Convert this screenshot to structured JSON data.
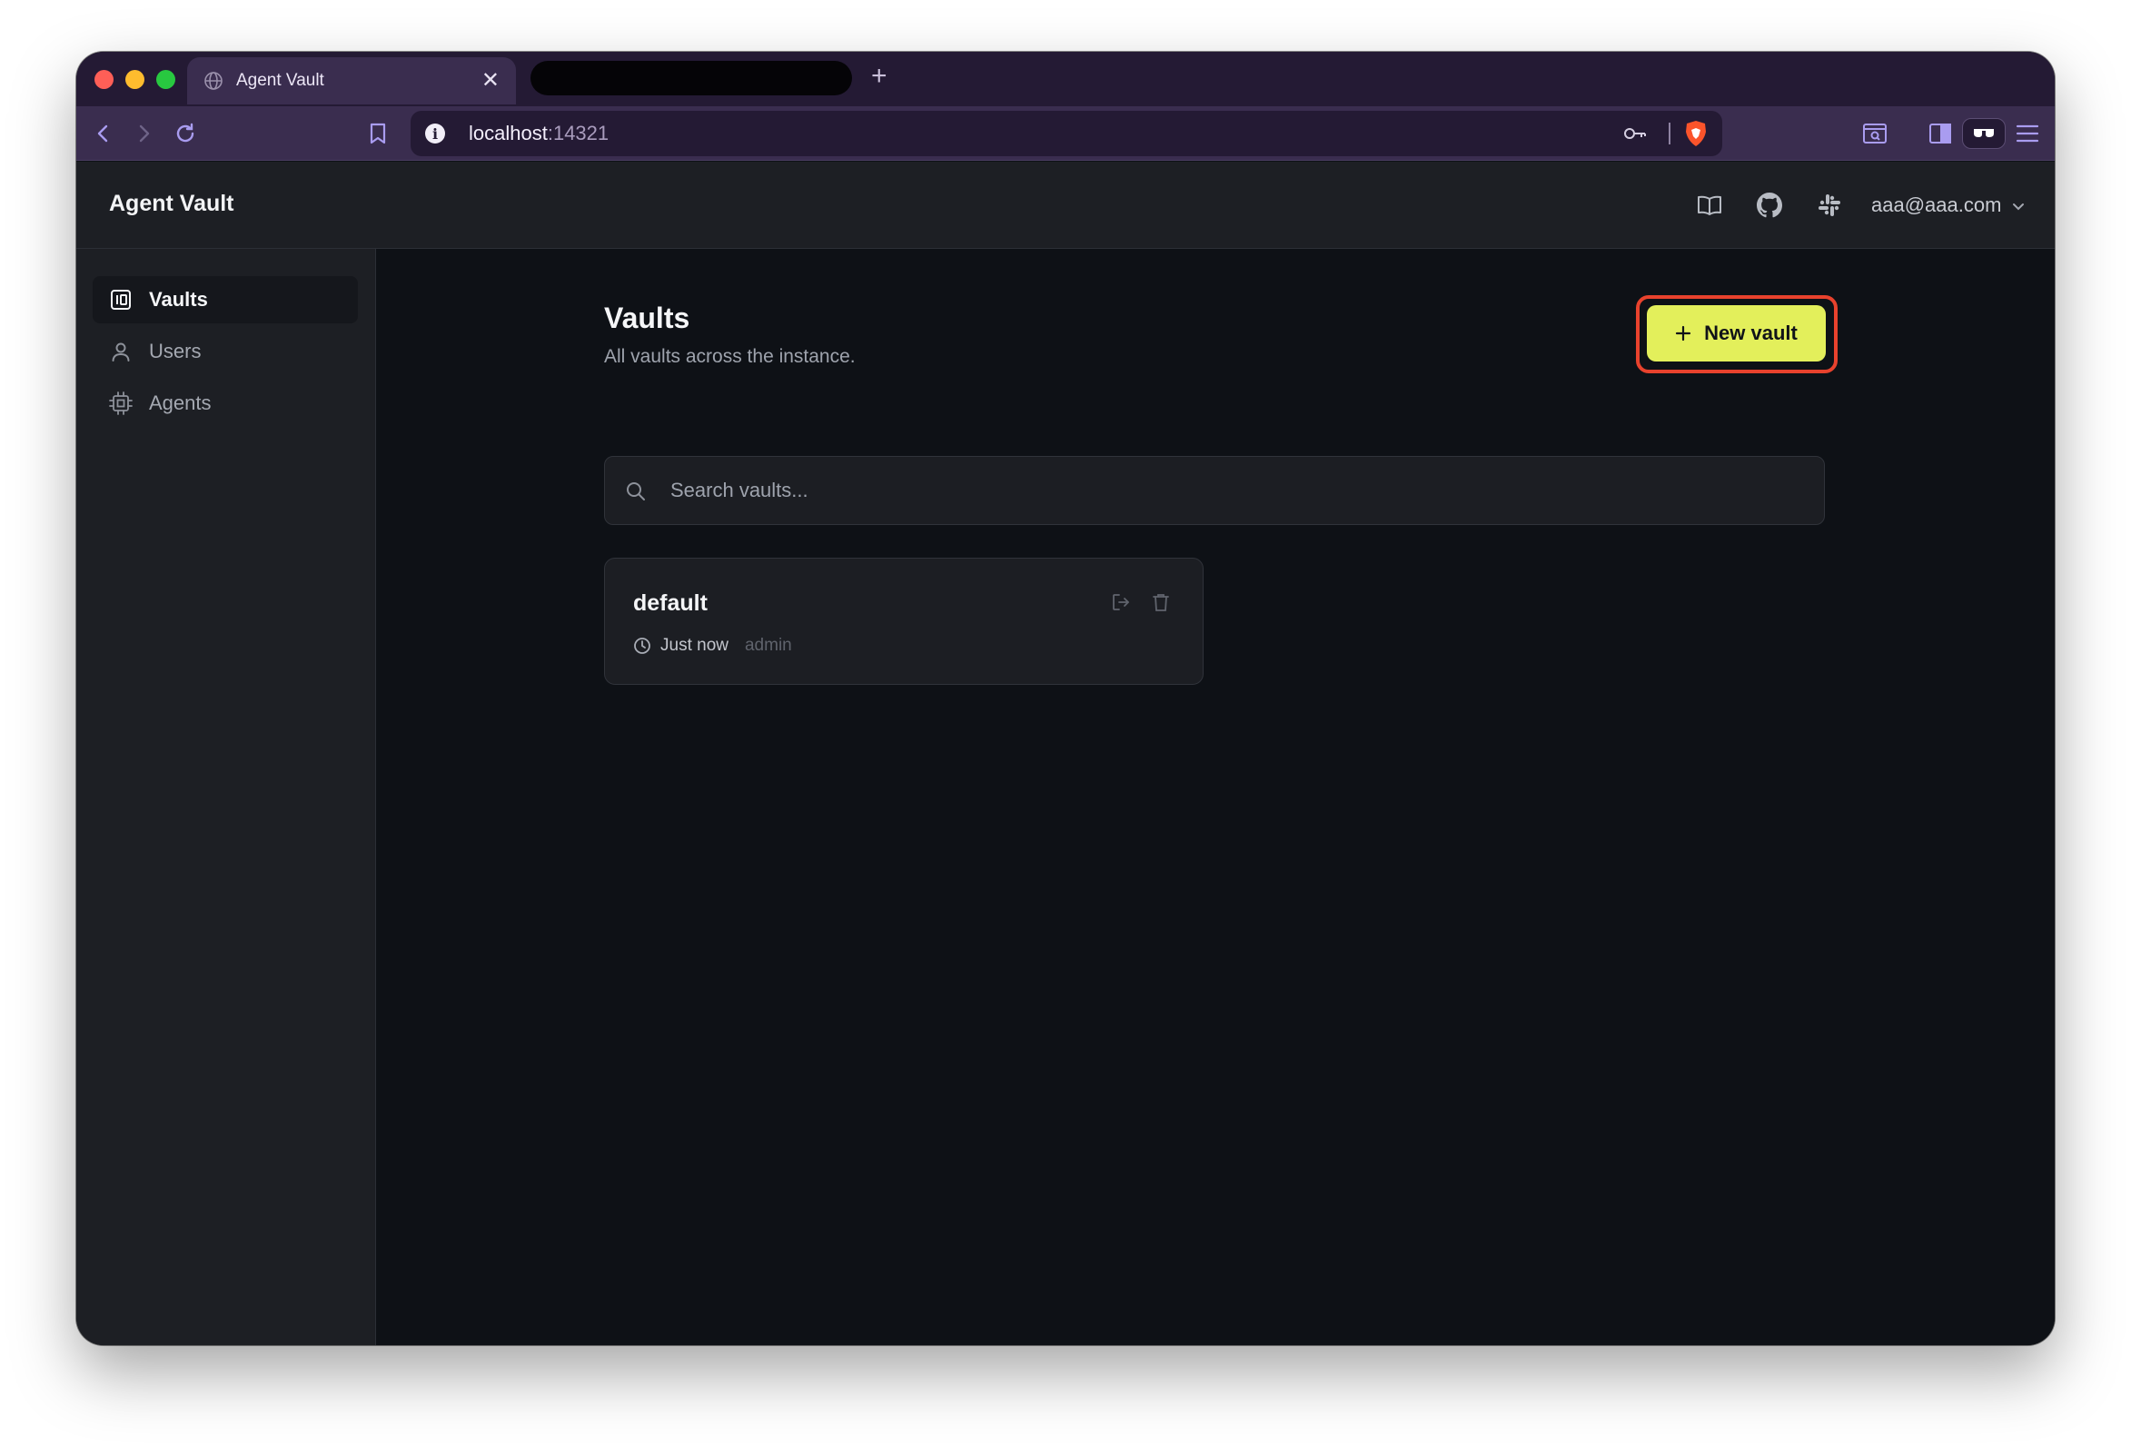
{
  "browser": {
    "tab_title": "Agent Vault",
    "tab_close": "✕",
    "new_tab": "+",
    "url_host": "localhost",
    "url_port": ":14321",
    "info_glyph": "i"
  },
  "app": {
    "brand": "Agent Vault",
    "user_email": "aaa@aaa.com"
  },
  "sidebar": {
    "items": [
      {
        "label": "Vaults",
        "icon": "vault-icon",
        "active": true
      },
      {
        "label": "Users",
        "icon": "user-icon",
        "active": false
      },
      {
        "label": "Agents",
        "icon": "cpu-icon",
        "active": false
      }
    ]
  },
  "main": {
    "title": "Vaults",
    "subtitle": "All vaults across the instance.",
    "new_button": "New vault",
    "search_placeholder": "Search vaults...",
    "vaults": [
      {
        "name": "default",
        "time": "Just now",
        "owner": "admin"
      }
    ]
  },
  "colors": {
    "accent_button": "#e3ef5b",
    "focus_ring": "#e8422d",
    "browser_chrome": "#3a2d4f",
    "page_bg": "#0e1116",
    "sidebar_bg": "#1d1f24"
  }
}
